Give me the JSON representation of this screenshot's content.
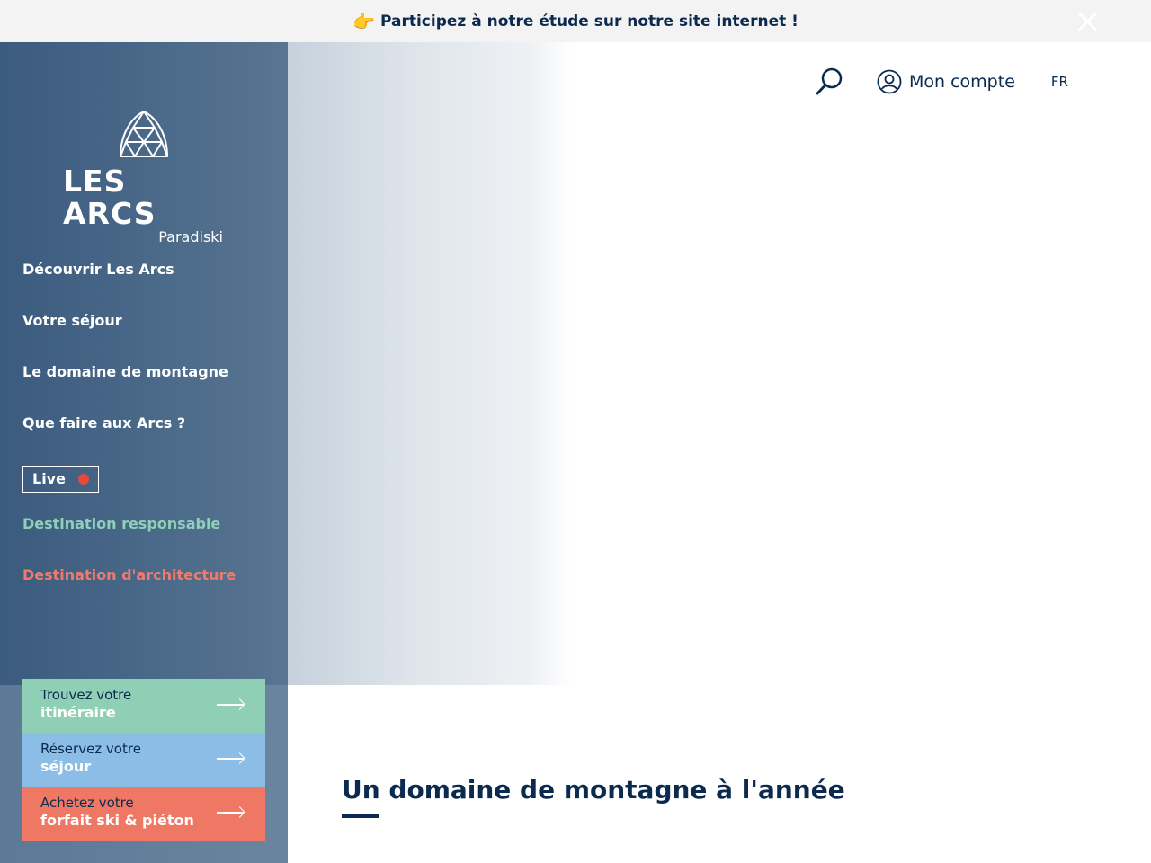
{
  "banner": {
    "icon": "pointing-hand-icon",
    "emoji": "👉",
    "text": "Participez à notre étude sur notre site internet !",
    "close_icon": "close-icon"
  },
  "header": {
    "search_icon": "search-icon",
    "account_icon": "user-circle-icon",
    "account_label": "Mon compte",
    "language": "FR"
  },
  "logo": {
    "brand": "LES ARCS",
    "sub": "Paradiski"
  },
  "nav": {
    "items": [
      {
        "label": "Découvrir Les Arcs"
      },
      {
        "label": "Votre séjour"
      },
      {
        "label": "Le domaine de montagne"
      },
      {
        "label": "Que faire aux Arcs ?"
      }
    ],
    "live_label": "Live",
    "responsible_label": "Destination responsable",
    "architecture_label": "Destination d'architecture"
  },
  "ctas": [
    {
      "line1": "Trouvez votre",
      "line2": "itinéraire",
      "color": "#8fcfb6"
    },
    {
      "line1": "Réservez votre",
      "line2": "séjour",
      "color": "#8bbde6"
    },
    {
      "line1": "Achetez votre",
      "line2": "forfait ski & piéton",
      "color": "#ef7865"
    }
  ],
  "main": {
    "section_title": "Un domaine de montagne à l'année"
  },
  "colors": {
    "navy": "#0b2a4f",
    "sidebar": "#3b5b7f",
    "green": "#8fd0b8",
    "coral": "#f07b6b",
    "live_dot": "#e34a3c"
  }
}
